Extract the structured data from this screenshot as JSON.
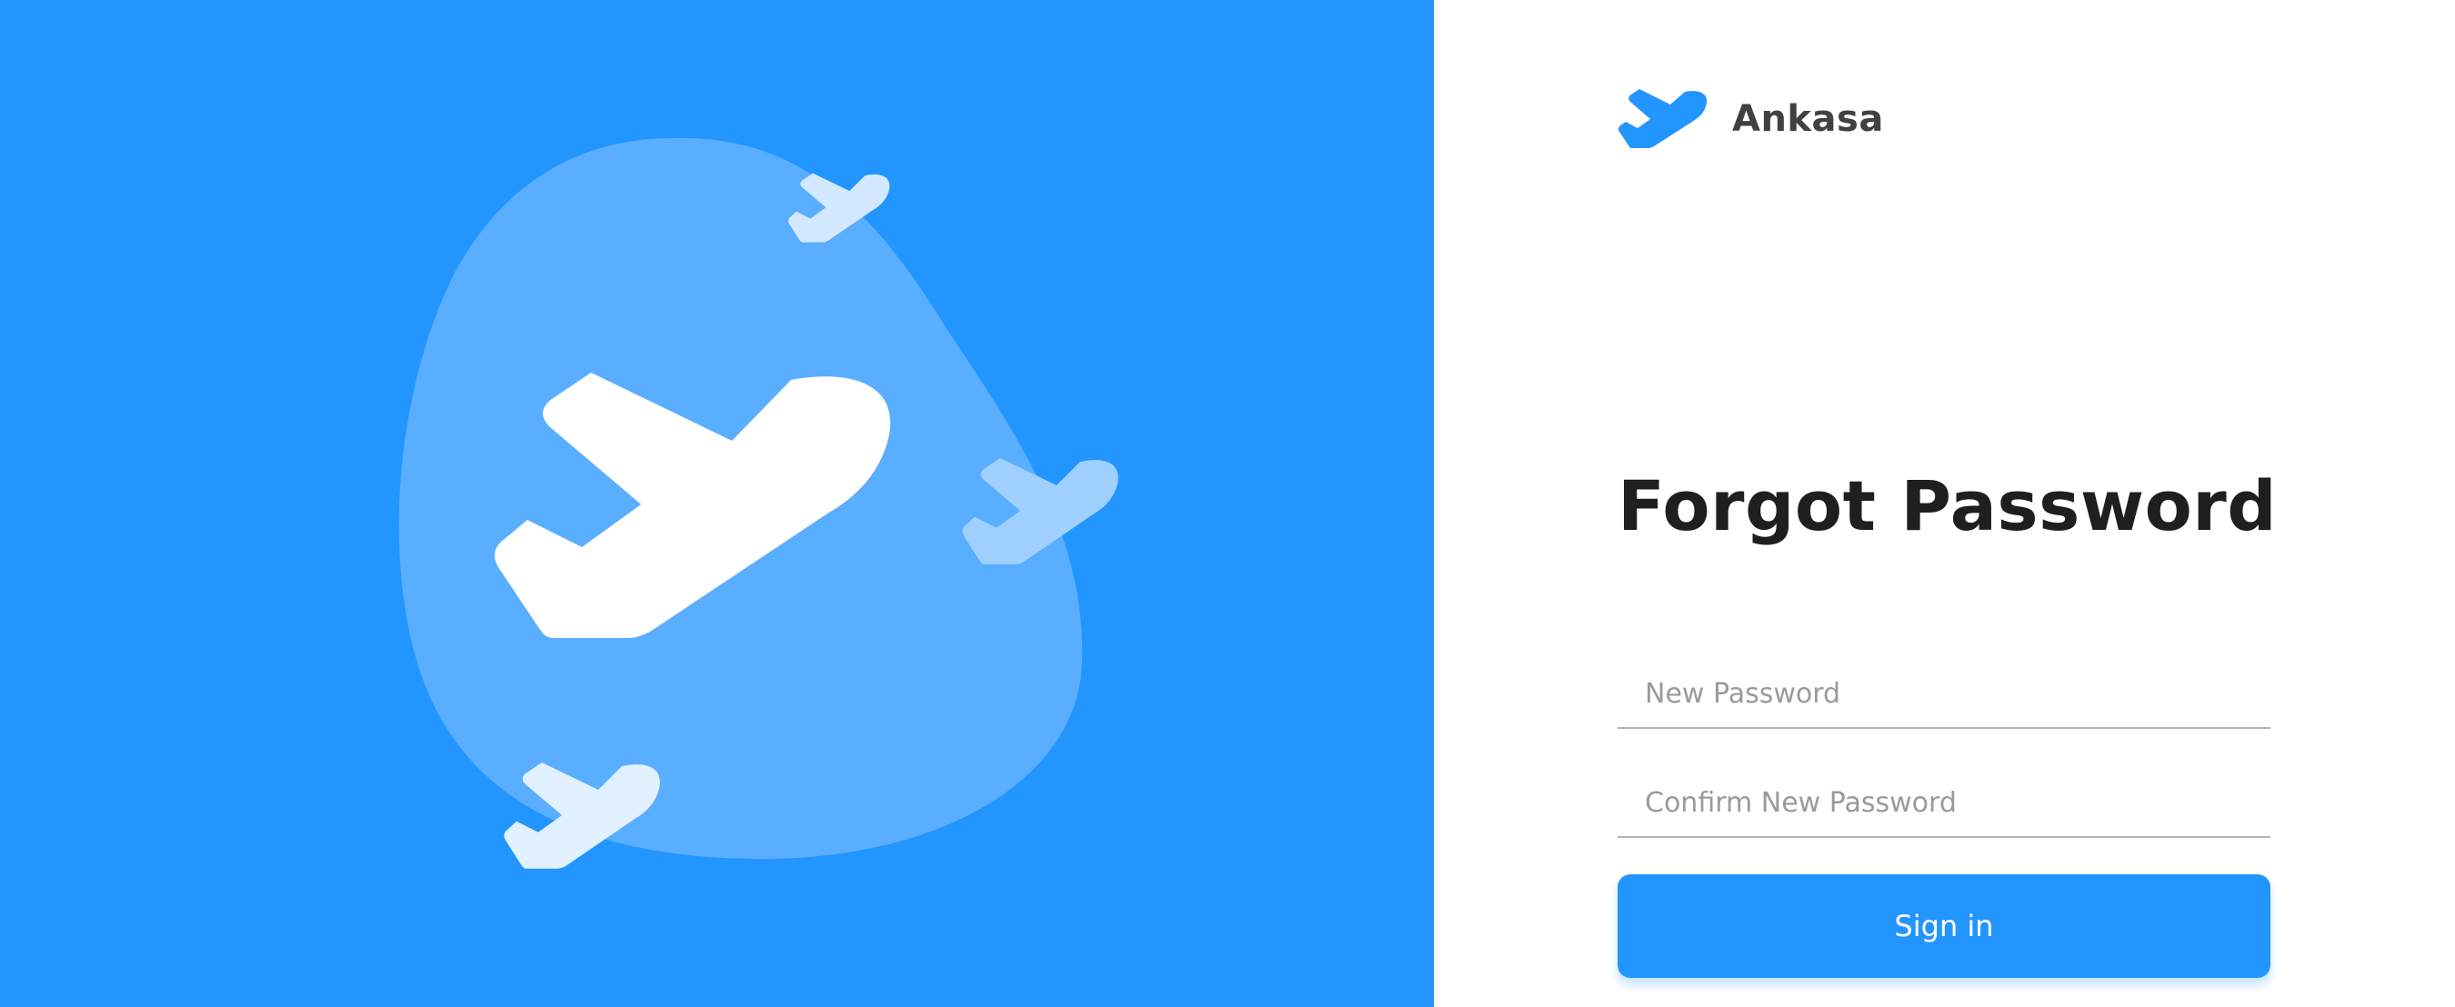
{
  "colors": {
    "accent": "#2395ff",
    "hero_blob": "#5aaeff",
    "title": "#1f1f1f",
    "brand_text": "#414141",
    "placeholder": "#9a9a9a"
  },
  "brand": {
    "name": "Ankasa",
    "icon": "plane-icon"
  },
  "form": {
    "title": "Forgot Password",
    "new_password_placeholder": "New Password",
    "confirm_password_placeholder": "Confirm New Password",
    "submit_label": "Sign in"
  },
  "hero": {
    "icons": [
      "large-plane-icon",
      "small-plane-icon",
      "small-plane-icon",
      "small-plane-icon"
    ]
  }
}
